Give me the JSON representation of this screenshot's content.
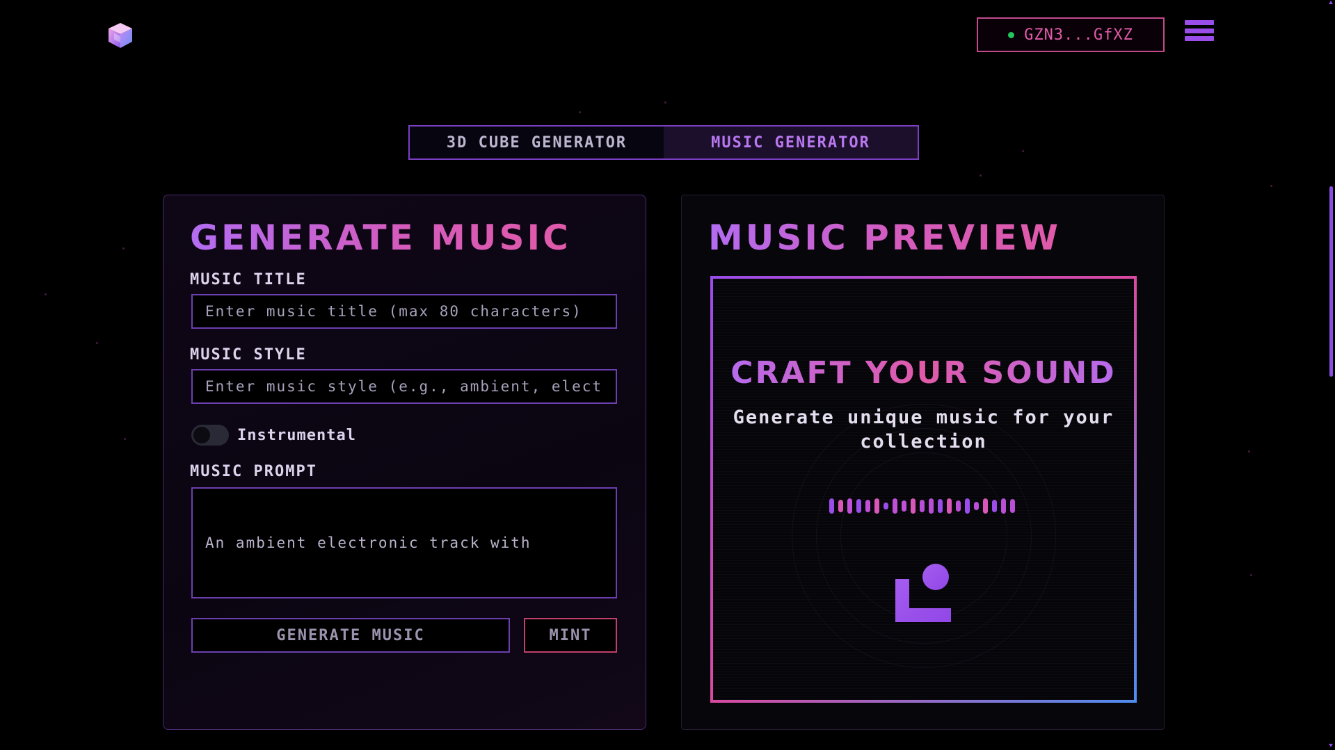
{
  "header": {
    "logo_icon": "cube-logo-icon",
    "wallet_label": "GZN3...GfXZ",
    "wallet_status_color": "#22c55e",
    "menu_icon": "hamburger-menu-icon"
  },
  "tabs": [
    {
      "label": "3D CUBE GENERATOR",
      "active": false
    },
    {
      "label": "MUSIC GENERATOR",
      "active": true
    }
  ],
  "generate_panel": {
    "title": "GENERATE MUSIC",
    "music_title": {
      "label": "MUSIC TITLE",
      "placeholder": "Enter music title (max 80 characters)",
      "value": ""
    },
    "music_style": {
      "label": "MUSIC STYLE",
      "placeholder": "Enter music style (e.g., ambient, electronic)",
      "value": ""
    },
    "instrumental": {
      "label": "Instrumental",
      "enabled": false
    },
    "music_prompt": {
      "label": "MUSIC PROMPT",
      "value": "An ambient electronic track with"
    },
    "generate_button": "GENERATE MUSIC",
    "mint_button": "MINT"
  },
  "preview_panel": {
    "title": "MUSIC PREVIEW",
    "headline": "CRAFT YOUR SOUND",
    "subtitle": "Generate unique music for your collection",
    "waveform_icon": "waveform-icon",
    "music_icon": "music-note-icon"
  },
  "colors": {
    "accent_purple": "#9b4dea",
    "accent_pink": "#e05aa8",
    "accent_blue": "#4f8df0",
    "background": "#000000"
  }
}
